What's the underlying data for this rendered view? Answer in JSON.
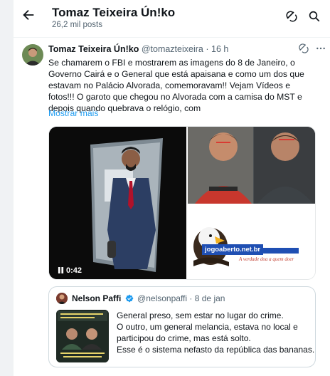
{
  "header": {
    "title": "Tomaz Teixeira Ún!ko",
    "post_count": "26,2 mil posts",
    "icons": [
      "back-arrow-icon",
      "grok-icon",
      "search-icon"
    ]
  },
  "tweet": {
    "author_name": "Tomaz Teixeira Ún!ko",
    "handle": "@tomazteixeira",
    "separator": "·",
    "time": "16 h",
    "text": "Se chamarem o FBI e mostrarem as imagens do 8 de Janeiro, o Governo Cairá e o General que está apaisana e como um dos que estavam no Palácio Alvorada, comemoravam!! Vejam Vídeos e fotos!!! O garoto que chegou no Alvorada com a camisa do MST e depois quando quebrava o relógio, com",
    "show_more": "Mostrar mais",
    "media": {
      "video_duration": "0:42",
      "logo_text": "jogoaberto.net.br",
      "logo_tagline": "A verdade doa a quem doer"
    }
  },
  "quote": {
    "author_name": "Nelson Paffi",
    "handle": "@nelsonpaffi",
    "separator": "·",
    "date": "8 de jan",
    "lines": [
      "General preso, sem estar no lugar do crime.",
      "O outro, um general melancia, estava no local e",
      "participou do crime, mas está solto.",
      "Esse é o sistema nefasto da república das bananas."
    ]
  },
  "colors": {
    "accent": "#1d9bf0",
    "text": "#0f1419",
    "secondary": "#536471",
    "border": "#cfd9de"
  }
}
